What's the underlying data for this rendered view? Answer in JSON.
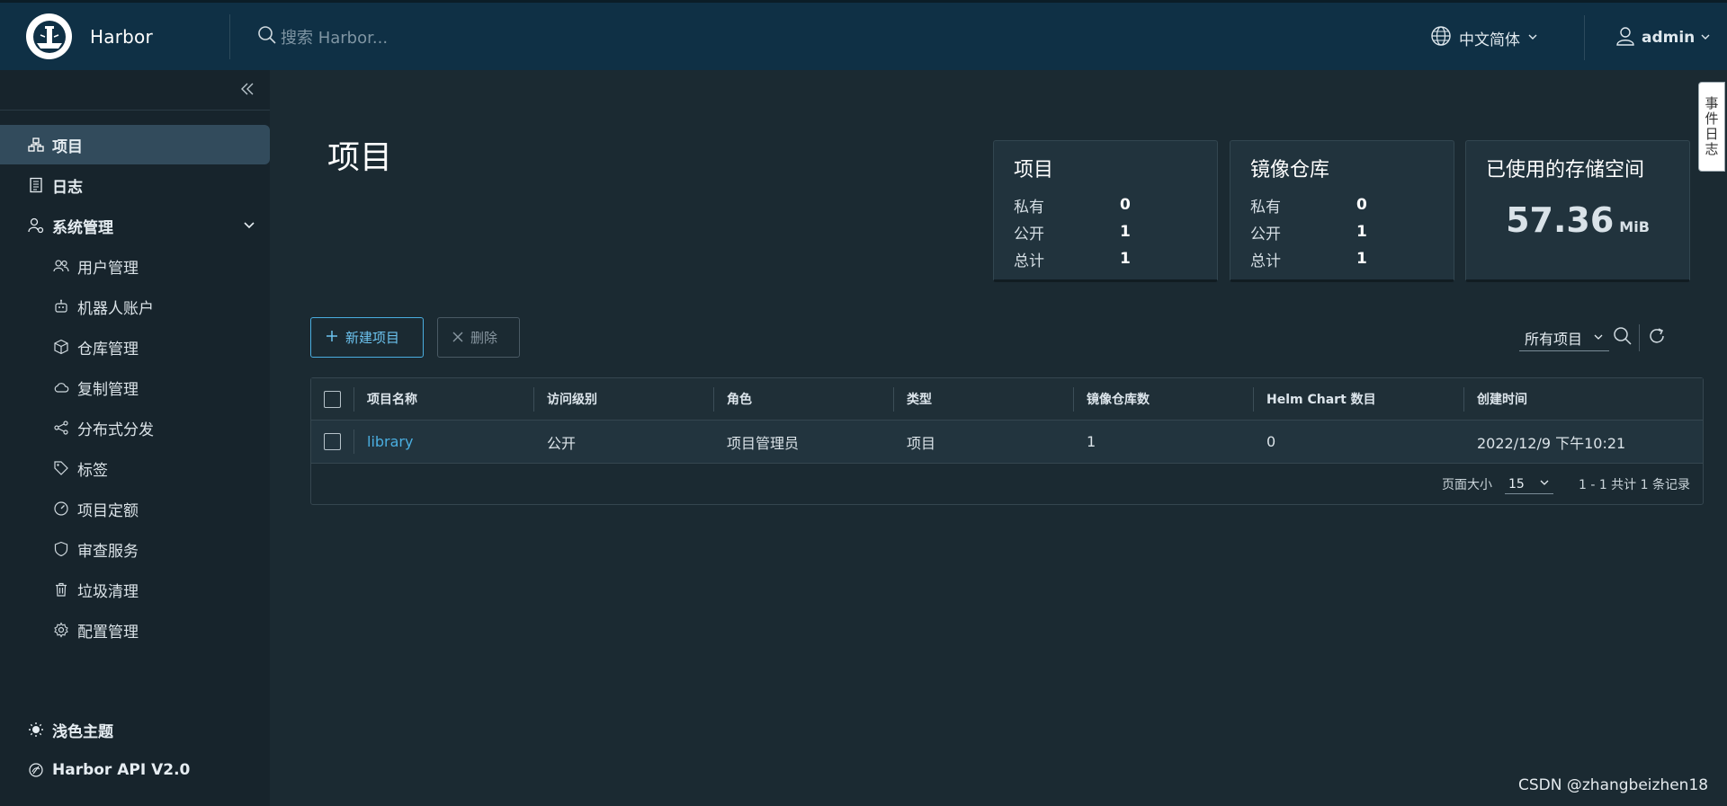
{
  "header": {
    "brand": "Harbor",
    "search_placeholder": "搜索 Harbor...",
    "language": "中文简体",
    "user": "admin"
  },
  "sidebar": {
    "items": [
      {
        "label": "项目",
        "icon": "projects-icon",
        "active": true
      },
      {
        "label": "日志",
        "icon": "logs-icon"
      },
      {
        "label": "系统管理",
        "icon": "admin-icon",
        "expanded": true
      }
    ],
    "sub_items": [
      {
        "label": "用户管理",
        "icon": "users-icon"
      },
      {
        "label": "机器人账户",
        "icon": "robot-icon"
      },
      {
        "label": "仓库管理",
        "icon": "registry-icon"
      },
      {
        "label": "复制管理",
        "icon": "cloud-icon"
      },
      {
        "label": "分布式分发",
        "icon": "share-icon"
      },
      {
        "label": "标签",
        "icon": "tag-icon"
      },
      {
        "label": "项目定额",
        "icon": "gauge-icon"
      },
      {
        "label": "审查服务",
        "icon": "shield-icon"
      },
      {
        "label": "垃圾清理",
        "icon": "trash-icon"
      },
      {
        "label": "配置管理",
        "icon": "gear-icon"
      }
    ],
    "footer": [
      {
        "label": "浅色主题",
        "icon": "sun-icon"
      },
      {
        "label": "Harbor API V2.0",
        "icon": "api-icon"
      }
    ]
  },
  "main": {
    "title": "项目",
    "cards": {
      "projects": {
        "title": "项目",
        "rows": [
          {
            "k": "私有",
            "v": "0"
          },
          {
            "k": "公开",
            "v": "1"
          },
          {
            "k": "总计",
            "v": "1"
          }
        ]
      },
      "repos": {
        "title": "镜像仓库",
        "rows": [
          {
            "k": "私有",
            "v": "0"
          },
          {
            "k": "公开",
            "v": "1"
          },
          {
            "k": "总计",
            "v": "1"
          }
        ]
      },
      "storage": {
        "title": "已使用的存储空间",
        "value": "57.36",
        "unit": "MiB"
      }
    },
    "buttons": {
      "new_project": "新建项目",
      "delete": "删除"
    },
    "filter": "所有项目",
    "table": {
      "headers": [
        "项目名称",
        "访问级别",
        "角色",
        "类型",
        "镜像仓库数",
        "Helm Chart 数目",
        "创建时间"
      ],
      "rows": [
        [
          "library",
          "公开",
          "项目管理员",
          "项目",
          "1",
          "0",
          "2022/12/9 下午10:21"
        ]
      ],
      "footer": {
        "page_size_label": "页面大小",
        "page_size": "15",
        "summary": "1 - 1 共计 1 条记录"
      }
    }
  },
  "side_tab": "事件日志",
  "watermark": "CSDN @zhangbeizhen18"
}
